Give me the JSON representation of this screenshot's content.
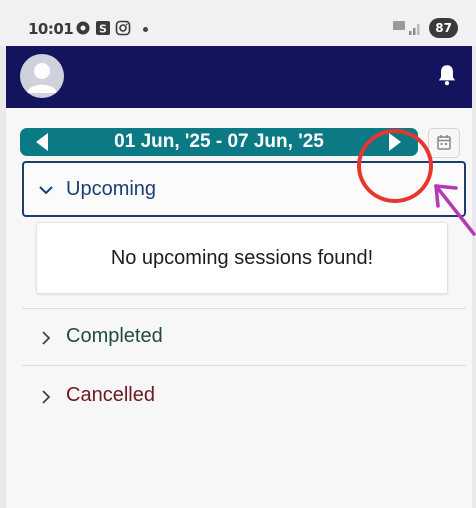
{
  "status_bar": {
    "time": "10:01",
    "battery": "87",
    "icons": [
      "settings-status-icon",
      "s-app-icon",
      "instagram-icon",
      "signal-icon"
    ]
  },
  "header": {
    "avatar_icon": "user-avatar-icon",
    "notification_icon": "bell-icon",
    "background": "#14135e"
  },
  "date_nav": {
    "range": "01 Jun, '25 - 07 Jun, '25",
    "prev_icon": "chevron-left-icon",
    "next_icon": "chevron-right-icon",
    "calendar_icon": "calendar-icon",
    "accent": "#0b7a84"
  },
  "sections": {
    "upcoming": {
      "label": "Upcoming",
      "expanded": true,
      "color": "#1a3f73"
    },
    "empty_message": "No upcoming sessions found!",
    "completed": {
      "label": "Completed",
      "expanded": false,
      "color": "#1f4d3d"
    },
    "cancelled": {
      "label": "Cancelled",
      "expanded": false,
      "color": "#6b1a22"
    }
  },
  "annotations": {
    "circle_color": "#e8352f",
    "arrow_color": "#b23ab6"
  }
}
